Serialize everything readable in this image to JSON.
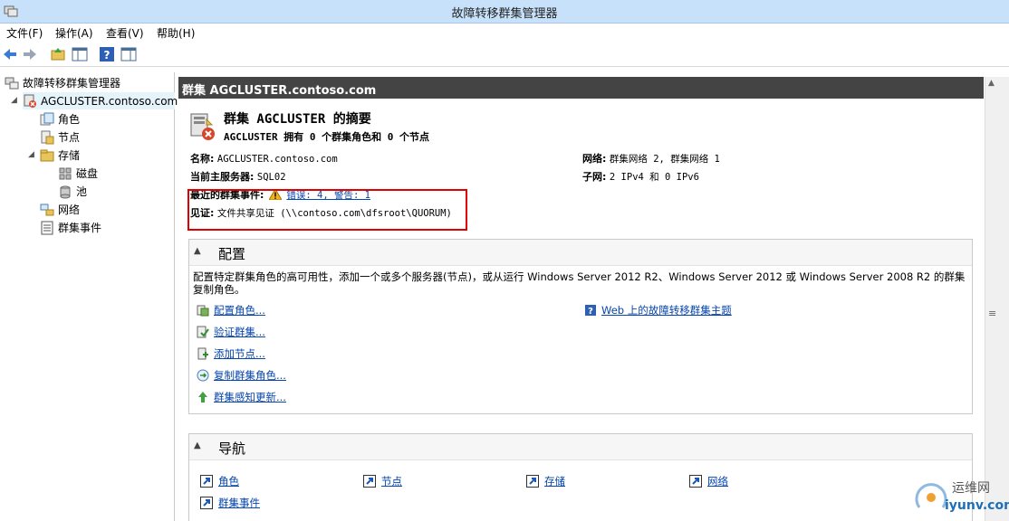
{
  "window": {
    "title": "故障转移群集管理器"
  },
  "menu": {
    "file": "文件(F)",
    "action": "操作(A)",
    "view": "查看(V)",
    "help": "帮助(H)"
  },
  "tree": {
    "root": "故障转移群集管理器",
    "cluster": "AGCLUSTER.contoso.com",
    "roles": "角色",
    "nodes": "节点",
    "storage": "存储",
    "disks": "磁盘",
    "pools": "池",
    "networks": "网络",
    "events": "群集事件"
  },
  "header": {
    "title": "群集 AGCLUSTER.contoso.com"
  },
  "summary": {
    "title": "群集 AGCLUSTER 的摘要",
    "subtitle": "AGCLUSTER 拥有 0 个群集角色和 0 个节点",
    "name_label": "名称:",
    "name_value": "AGCLUSTER.contoso.com",
    "host_label": "当前主服务器:",
    "host_value": "SQL02",
    "events_label": "最近的群集事件:",
    "events_value": "错误: 4, 警告: 1",
    "witness_label": "见证:",
    "witness_value": "文件共享见证 (\\\\contoso.com\\dfsroot\\QUORUM)",
    "network_label": "网络:",
    "network_value": "群集网络 2, 群集网络 1",
    "subnet_label": "子网:",
    "subnet_value": "2 IPv4 和 0 IPv6"
  },
  "config": {
    "title": "配置",
    "description": "配置特定群集角色的高可用性，添加一个或多个服务器(节点)，或从运行 Windows Server 2012 R2、Windows Server 2012 或 Windows Server 2008 R2 的群集复制角色。",
    "actions": [
      "配置角色...",
      "验证群集...",
      "添加节点...",
      "复制群集角色...",
      "群集感知更新..."
    ],
    "web_link": "Web 上的故障转移群集主题"
  },
  "navigation": {
    "title": "导航",
    "links": [
      "角色",
      "节点",
      "存储",
      "网络",
      "群集事件"
    ]
  },
  "watermark": {
    "cn": "运维网",
    "url": "iyunv.com"
  }
}
